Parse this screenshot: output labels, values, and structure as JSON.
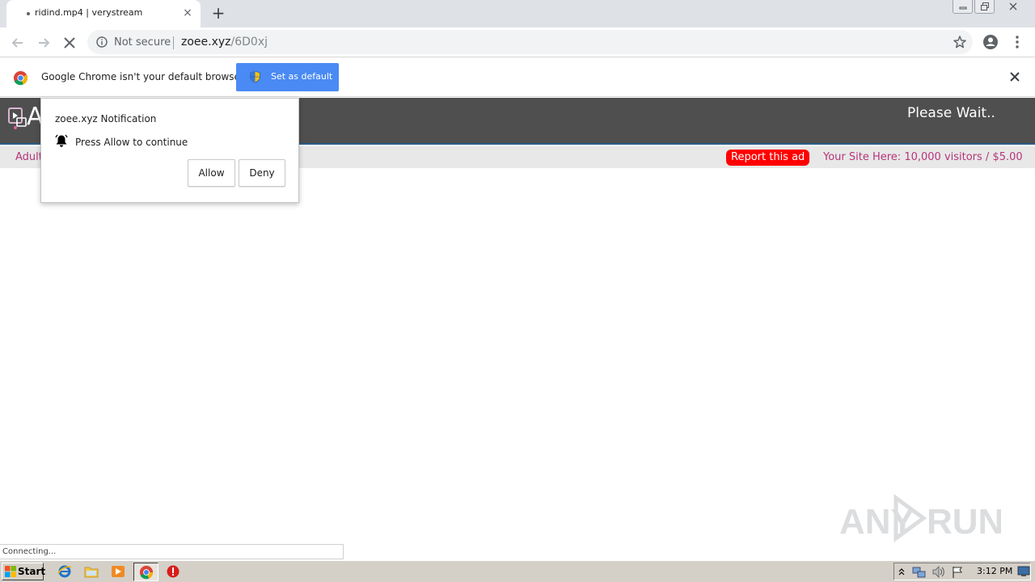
{
  "tab": {
    "title": "ridind.mp4 | verystream",
    "close_glyph": "×",
    "new_tab_glyph": "+"
  },
  "address": {
    "security_label": "Not secure",
    "host": "zoee.xyz",
    "path": "/6D0xj"
  },
  "infobar": {
    "message": "Google Chrome isn't your default browser",
    "button_label": "Set as default",
    "button_color": "#4a8af4"
  },
  "site": {
    "logo_letter": "A",
    "header_text": "Please Wait..",
    "subbar_left": "Adult",
    "report_label": "Report this ad",
    "promo": "Your Site Here: 10,000 visitors / $5.00",
    "header_color": "#4f4f4f",
    "accent_color": "#b5357a"
  },
  "notification": {
    "title": "zoee.xyz Notification",
    "message": "Press Allow to continue",
    "allow_label": "Allow",
    "deny_label": "Deny"
  },
  "status": {
    "text": "Connecting..."
  },
  "taskbar": {
    "start_label": "Start",
    "clock": "3:12 PM"
  },
  "icons": [
    "back-arrow-icon",
    "forward-arrow-icon",
    "stop-loading-icon",
    "info-icon",
    "star-icon",
    "profile-icon",
    "menu-icon",
    "chrome-logo-icon",
    "shield-icon",
    "close-icon",
    "bell-icon"
  ]
}
